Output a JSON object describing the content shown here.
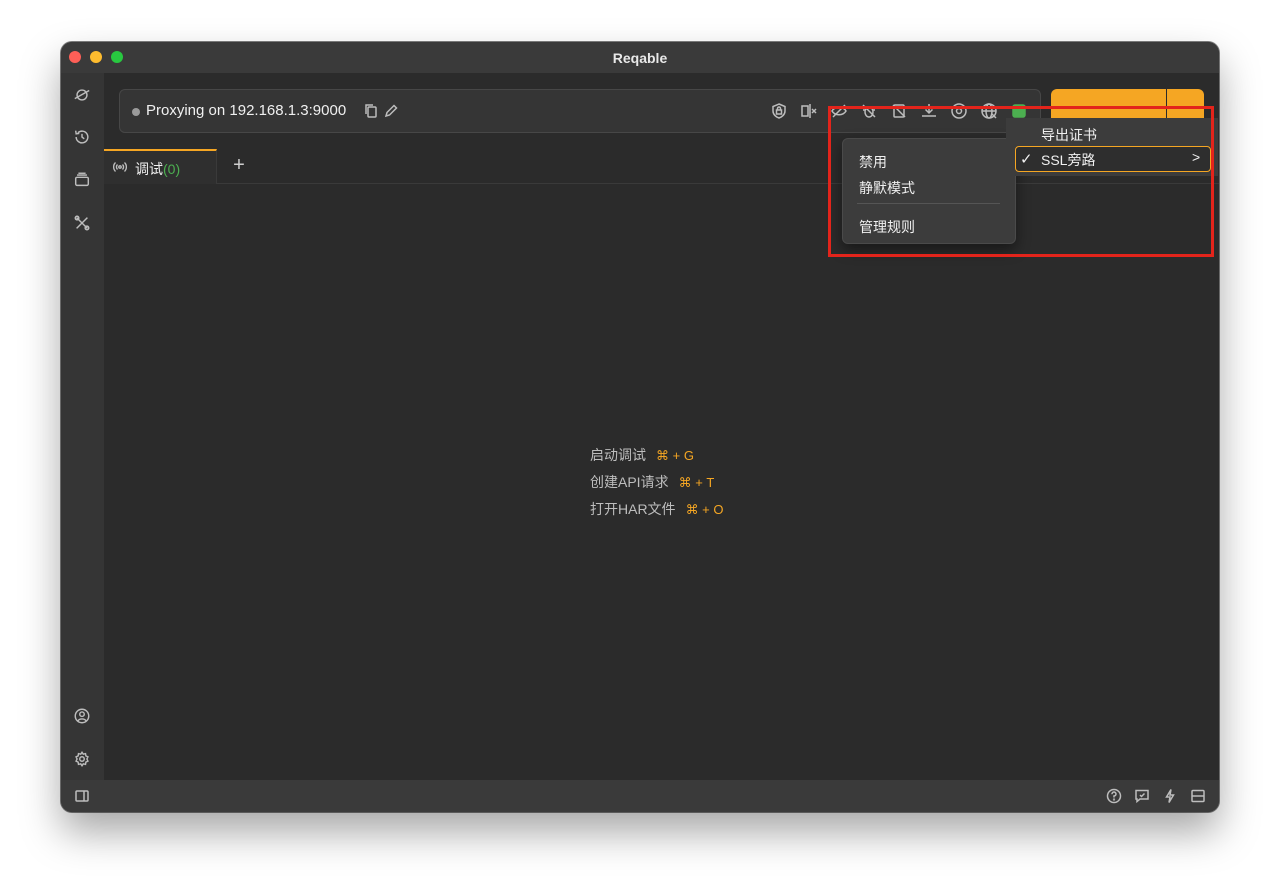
{
  "window": {
    "title": "Reqable"
  },
  "sidebar": {
    "top_icons": [
      "planet-icon",
      "history-icon",
      "layers-icon",
      "tools-icon"
    ],
    "bottom_icons": [
      "account-icon",
      "settings-icon"
    ]
  },
  "proxy": {
    "status_text": "Proxying on 192.168.1.3:9000",
    "toolbar_icons": [
      "ssl-shield-icon",
      "split-icon",
      "no-eye-icon",
      "no-bug-icon",
      "no-doc-icon",
      "download-icon",
      "record-icon",
      "globe-off-icon",
      "cert-icon"
    ]
  },
  "tabs": [
    {
      "label": "调试",
      "count": "(0)"
    }
  ],
  "tab_add": "+",
  "hints": [
    {
      "label": "启动调试",
      "shortcut": "⌘ + G"
    },
    {
      "label": "创建API请求",
      "shortcut": "⌘ + T"
    },
    {
      "label": "打开HAR文件",
      "shortcut": "⌘ + O"
    }
  ],
  "context_menu": {
    "items": [
      "禁用",
      "静默模式",
      "管理规则"
    ]
  },
  "submenu": {
    "export_cert": "导出证书",
    "ssl_bypass": "SSL旁路",
    "check": "✓",
    "chevron": ">"
  },
  "colors": {
    "accent": "#f5a623",
    "highlight": "#e3241b",
    "count": "#4caf50"
  }
}
